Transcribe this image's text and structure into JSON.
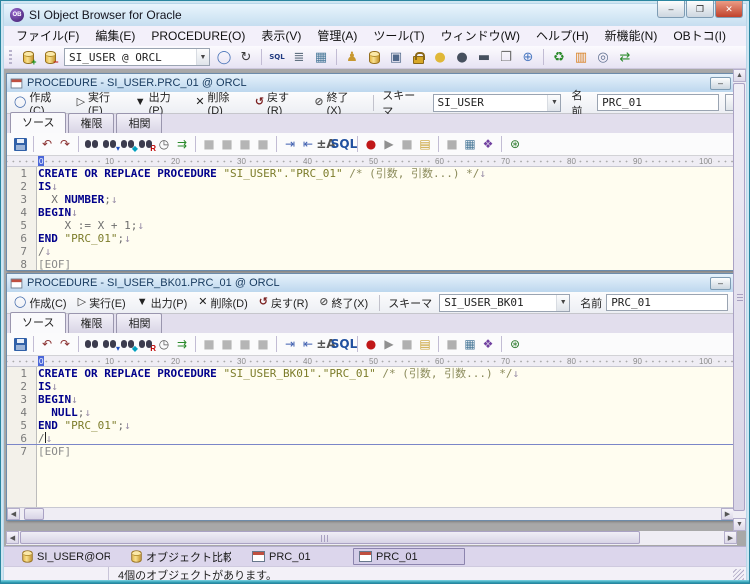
{
  "app": {
    "title": "SI Object Browser for Oracle",
    "icon_label": "OB"
  },
  "window_controls": [
    {
      "name": "minimize-button",
      "glyph": "–"
    },
    {
      "name": "maximize-button",
      "glyph": "❐"
    },
    {
      "name": "close-button",
      "glyph": "✕"
    }
  ],
  "menu": {
    "items": [
      "ファイル(F)",
      "編集(E)",
      "PROCEDURE(O)",
      "表示(V)",
      "管理(A)",
      "ツール(T)",
      "ウィンドウ(W)",
      "ヘルプ(H)",
      "新機能(N)",
      "OBトコ(I)"
    ]
  },
  "main_toolbar": {
    "pre_icons": [
      {
        "name": "connect-database-icon",
        "type": "cyl-plus"
      },
      {
        "name": "disconnect-database-icon",
        "type": "cyl-minus"
      }
    ],
    "connection_value": "SI_USER @ ORCL",
    "items": [
      {
        "name": "cancel-icon",
        "glyph": "◯",
        "color": "#4a74b8"
      },
      {
        "name": "refresh-icon",
        "glyph": "↻",
        "color": "#3a3a3a"
      },
      {
        "sep": true
      },
      {
        "name": "sql-editor-icon",
        "glyph": "SQL",
        "color": "#203a80",
        "cls": "txt"
      },
      {
        "name": "script-icon",
        "glyph": "≣",
        "color": "#607080"
      },
      {
        "name": "grid-icon",
        "glyph": "▦",
        "color": "#4a7a9a"
      },
      {
        "sep": true
      },
      {
        "name": "user-icon",
        "glyph": "♟",
        "color": "#c89830"
      },
      {
        "name": "database-list-icon",
        "type": "cyl"
      },
      {
        "name": "computer-icon",
        "glyph": "▣",
        "color": "#50688a"
      },
      {
        "name": "lock-icon",
        "type": "lock"
      },
      {
        "name": "session-icon",
        "glyph": "●",
        "color": "#e0b838"
      },
      {
        "name": "role-icon",
        "glyph": "●",
        "color": "#46505e"
      },
      {
        "name": "profile-icon",
        "glyph": "▬",
        "color": "#46505e"
      },
      {
        "name": "copy-icon",
        "glyph": "❐",
        "color": "#707070"
      },
      {
        "name": "network-icon",
        "glyph": "⊕",
        "color": "#4a78c0"
      },
      {
        "sep": true
      },
      {
        "name": "refresh-objects-icon",
        "glyph": "♻",
        "color": "#2a8a2a"
      },
      {
        "name": "compare-icon",
        "glyph": "▥",
        "color": "#d88020"
      },
      {
        "name": "sql-monitor-icon",
        "glyph": "◎",
        "color": "#607090"
      },
      {
        "name": "data-transfer-icon",
        "glyph": "⇄",
        "color": "#2a8a2a"
      }
    ]
  },
  "editor_toolbar": {
    "items": [
      {
        "name": "save-icon",
        "type": "save"
      },
      {
        "sep": true
      },
      {
        "name": "undo-icon",
        "glyph": "↶",
        "color": "#8a3030"
      },
      {
        "name": "redo-icon",
        "glyph": "↷",
        "color": "#8a3030"
      },
      {
        "sep": true
      },
      {
        "name": "find-icon",
        "type": "bino"
      },
      {
        "name": "find-next-icon",
        "type": "bino",
        "badge": "▾",
        "badgeColor": "#2050c0"
      },
      {
        "name": "find-prev-icon",
        "type": "bino",
        "badge": "◆",
        "badgeColor": "#00a0c0"
      },
      {
        "name": "replace-icon",
        "type": "bino",
        "badge": "R",
        "badgeColor": "#c00000"
      },
      {
        "name": "find-resume-icon",
        "glyph": "◷",
        "color": "#555555"
      },
      {
        "name": "goto-line-icon",
        "glyph": "⇉",
        "color": "#2a8a2a"
      },
      {
        "sep": true
      },
      {
        "name": "disabled-button-1-icon",
        "glyph": "■",
        "color": "#aeaeae",
        "disabled": true
      },
      {
        "name": "disabled-button-2-icon",
        "glyph": "■",
        "color": "#aeaeae",
        "disabled": true
      },
      {
        "name": "disabled-button-3-icon",
        "glyph": "■",
        "color": "#aeaeae",
        "disabled": true
      },
      {
        "name": "disabled-button-4-icon",
        "glyph": "■",
        "color": "#aeaeae",
        "disabled": true
      },
      {
        "sep": true
      },
      {
        "name": "indent-icon",
        "glyph": "⇥",
        "color": "#4060b0"
      },
      {
        "name": "outdent-icon",
        "glyph": "⇤",
        "color": "#4060b0"
      },
      {
        "name": "case-convert-icon",
        "glyph": "±A",
        "color": "#555555",
        "cls": "txt"
      },
      {
        "name": "sql-format-icon",
        "glyph": "SQL",
        "color": "#2050a0",
        "cls": "txt"
      },
      {
        "sep": true
      },
      {
        "name": "macro-record-icon",
        "glyph": "●",
        "color": "#c01818"
      },
      {
        "name": "macro-play-icon",
        "glyph": "▶",
        "color": "#909090"
      },
      {
        "name": "macro-stop-icon",
        "glyph": "■",
        "color": "#b0b0b0"
      },
      {
        "name": "macro-open-icon",
        "glyph": "▤",
        "color": "#c8a030"
      },
      {
        "sep": true
      },
      {
        "name": "option-icon",
        "glyph": "■",
        "color": "#b0b0b0"
      },
      {
        "name": "data-grid-icon",
        "glyph": "▦",
        "color": "#4a7a9a"
      },
      {
        "name": "dictionary-icon",
        "glyph": "❖",
        "color": "#7040a0"
      },
      {
        "sep": true
      },
      {
        "name": "compile-icon",
        "glyph": "⊛",
        "color": "#2a7a2a"
      }
    ]
  },
  "ruler": {
    "marks": [
      "0",
      "10",
      "20",
      "30",
      "40",
      "50",
      "60",
      "70",
      "80",
      "90",
      "100"
    ]
  },
  "mdi": {
    "windows": [
      {
        "title": "PROCEDURE - SI_USER.PRC_01 @ ORCL",
        "actions": [
          {
            "name": "create",
            "glyph": "◯",
            "color": "#3a64a8",
            "label": "作成(C)"
          },
          {
            "name": "execute",
            "glyph": "▷",
            "color": "#333333",
            "label": "実行(E)"
          },
          {
            "name": "output",
            "glyph": "▼",
            "color": "#222222",
            "label": "出力(P)"
          },
          {
            "name": "delete",
            "glyph": "✕",
            "color": "#222222",
            "label": "削除(D)"
          },
          {
            "name": "revert",
            "glyph": "↺",
            "color": "#7a2020",
            "label": "戻す(R)"
          },
          {
            "name": "exit",
            "glyph": "⊘",
            "color": "#555555",
            "label": "終了(X)"
          }
        ],
        "schema_label": "スキーマ",
        "schema_value": "SI_USER",
        "name_label": "名前",
        "name_value": "PRC_01",
        "tabs": [
          {
            "label": "ソース",
            "active": true
          },
          {
            "label": "権限",
            "active": false
          },
          {
            "label": "相関",
            "active": false
          }
        ],
        "code": [
          {
            "segs": [
              {
                "t": "CREATE OR REPLACE PROCEDURE ",
                "c": "kw"
              },
              {
                "t": "\"SI_USER\".\"PRC_01\"",
                "c": "str"
              },
              {
                "t": " /* (引数, 引数...) */",
                "c": "com"
              },
              {
                "t": "↓",
                "c": "eol"
              }
            ]
          },
          {
            "segs": [
              {
                "t": "IS",
                "c": "kw"
              },
              {
                "t": "↓",
                "c": "eol"
              }
            ]
          },
          {
            "segs": [
              {
                "t": "  X ",
                "c": "id"
              },
              {
                "t": "NUMBER",
                "c": "kw"
              },
              {
                "t": ";",
                "c": "id"
              },
              {
                "t": "↓",
                "c": "eol"
              }
            ]
          },
          {
            "segs": [
              {
                "t": "BEGIN",
                "c": "kw"
              },
              {
                "t": "↓",
                "c": "eol"
              }
            ]
          },
          {
            "segs": [
              {
                "t": "    X := X + 1;",
                "c": "id"
              },
              {
                "t": "↓",
                "c": "eol"
              }
            ]
          },
          {
            "segs": [
              {
                "t": "END",
                "c": "kw"
              },
              {
                "t": " ",
                "c": "id"
              },
              {
                "t": "\"PRC_01\"",
                "c": "str"
              },
              {
                "t": ";",
                "c": "id"
              },
              {
                "t": "↓",
                "c": "eol"
              }
            ]
          },
          {
            "segs": [
              {
                "t": "/",
                "c": "id"
              },
              {
                "t": "↓",
                "c": "eol"
              }
            ]
          },
          {
            "segs": [
              {
                "t": "[EOF]",
                "c": "eof"
              }
            ]
          }
        ]
      },
      {
        "title": "PROCEDURE - SI_USER_BK01.PRC_01 @ ORCL",
        "actions": [
          {
            "name": "create",
            "glyph": "◯",
            "color": "#3a64a8",
            "label": "作成(C)"
          },
          {
            "name": "execute",
            "glyph": "▷",
            "color": "#333333",
            "label": "実行(E)"
          },
          {
            "name": "output",
            "glyph": "▼",
            "color": "#222222",
            "label": "出力(P)"
          },
          {
            "name": "delete",
            "glyph": "✕",
            "color": "#222222",
            "label": "削除(D)"
          },
          {
            "name": "revert",
            "glyph": "↺",
            "color": "#7a2020",
            "label": "戻す(R)"
          },
          {
            "name": "exit",
            "glyph": "⊘",
            "color": "#555555",
            "label": "終了(X)"
          }
        ],
        "schema_label": "スキーマ",
        "schema_value": "SI_USER_BK01",
        "name_label": "名前",
        "name_value": "PRC_01",
        "tabs": [
          {
            "label": "ソース",
            "active": true
          },
          {
            "label": "権限",
            "active": false
          },
          {
            "label": "相関",
            "active": false
          }
        ],
        "code": [
          {
            "segs": [
              {
                "t": "CREATE OR REPLACE PROCEDURE ",
                "c": "kw"
              },
              {
                "t": "\"SI_USER_BK01\".\"PRC_01\"",
                "c": "str"
              },
              {
                "t": " /* (引数, 引数...) */",
                "c": "com"
              },
              {
                "t": "↓",
                "c": "eol"
              }
            ]
          },
          {
            "segs": [
              {
                "t": "IS",
                "c": "kw"
              },
              {
                "t": "↓",
                "c": "eol"
              }
            ]
          },
          {
            "segs": [
              {
                "t": "BEGIN",
                "c": "kw"
              },
              {
                "t": "↓",
                "c": "eol"
              }
            ]
          },
          {
            "segs": [
              {
                "t": "  ",
                "c": "id"
              },
              {
                "t": "NULL",
                "c": "kw"
              },
              {
                "t": ";",
                "c": "id"
              },
              {
                "t": "↓",
                "c": "eol"
              }
            ]
          },
          {
            "segs": [
              {
                "t": "END",
                "c": "kw"
              },
              {
                "t": " ",
                "c": "id"
              },
              {
                "t": "\"PRC_01\"",
                "c": "str"
              },
              {
                "t": ";",
                "c": "id"
              },
              {
                "t": "↓",
                "c": "eol"
              }
            ]
          },
          {
            "cur": true,
            "segs": [
              {
                "t": "/",
                "c": "id"
              },
              {
                "t": "",
                "c": "caret"
              },
              {
                "t": "↓",
                "c": "eol"
              }
            ]
          },
          {
            "segs": [
              {
                "t": "[EOF]",
                "c": "eof"
              }
            ]
          }
        ]
      }
    ]
  },
  "taskbar": {
    "items": [
      {
        "icon": "database-icon",
        "label": "SI_USER@ORCL",
        "active": false
      },
      {
        "icon": "database-icon",
        "label": "オブジェクト比較",
        "active": false
      },
      {
        "icon": "window-icon",
        "label": "PRC_01",
        "active": false
      },
      {
        "icon": "window-icon",
        "label": "PRC_01",
        "active": true
      }
    ]
  },
  "statusbar": {
    "text": "4個のオブジェクトがあります。"
  }
}
